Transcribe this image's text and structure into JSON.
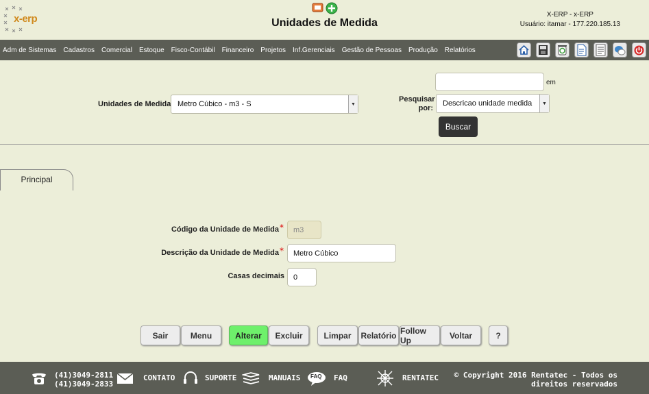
{
  "header": {
    "logo_text": "x-erp",
    "page_title": "Unidades de Medida",
    "system_name": "X-ERP - x-ERP",
    "user_info": "Usuário: itamar - 177.220.185.13"
  },
  "menu": {
    "items": [
      "Adm de Sistemas",
      "Cadastros",
      "Comercial",
      "Estoque",
      "Fisco-Contábil",
      "Financeiro",
      "Projetos",
      "Inf.Gerenciais",
      "Gestão de Pessoas",
      "Produção",
      "Relatórios"
    ],
    "toolbar_icons": [
      "home-icon",
      "save-icon",
      "recycle-icon",
      "document-icon",
      "list-icon",
      "chat-icon",
      "power-icon"
    ]
  },
  "search": {
    "unit_label": "Unidades de Medida",
    "unit_selected": "Metro Cúbico - m3 - S",
    "search_value": "",
    "em_label": "em",
    "search_by_label_1": "Pesquisar",
    "search_by_label_2": "por:",
    "search_by_selected": "Descricao unidade medida",
    "search_button": "Buscar"
  },
  "tabs": {
    "principal": "Principal"
  },
  "form": {
    "code_label": "Código da Unidade de Medida",
    "code_value": "m3",
    "desc_label": "Descrição da Unidade de Medida",
    "desc_value": "Metro Cúbico",
    "decimals_label": "Casas decimais",
    "decimals_value": "0",
    "required_mark": "*"
  },
  "actions": {
    "sair": "Sair",
    "menu": "Menu",
    "alterar": "Alterar",
    "excluir": "Excluir",
    "limpar": "Limpar",
    "relatorio": "Relatório",
    "follow_up": "Follow Up",
    "voltar": "Voltar",
    "help": "?"
  },
  "footer": {
    "phone_1": "(41)3049-2811",
    "phone_2": "(41)3049-2833",
    "contato": "CONTATO",
    "suporte": "SUPORTE",
    "manuais": "MANUAIS",
    "faq": "FAQ",
    "faq_icon_text": "FAQ",
    "rentatec": "RENTATEC",
    "copyright_1": "© Copyright 2016 Rentatec - Todos os",
    "copyright_2": "direitos reservados"
  },
  "colors": {
    "background": "#eceed9",
    "bar": "#5b5d55",
    "accent_green": "#6ef06b"
  }
}
